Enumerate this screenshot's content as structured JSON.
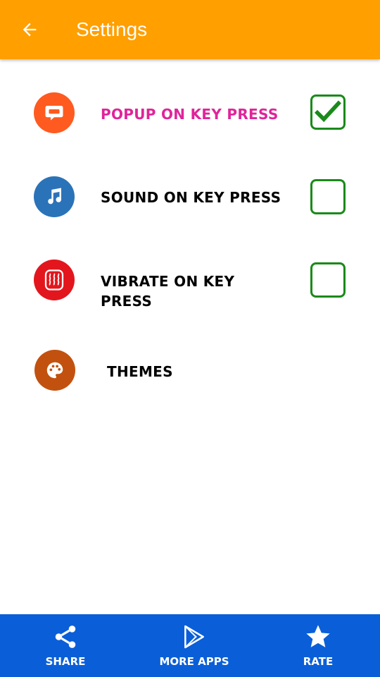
{
  "appbar": {
    "title": "Settings",
    "back_icon": "arrow-left-icon",
    "color": "#ff9f00"
  },
  "settings": [
    {
      "label": "POPUP ON KEY PRESS",
      "icon": "chat-bubble-icon",
      "icon_color": "#ff5a1f",
      "label_color": "#e0249a",
      "checked": true
    },
    {
      "label": "SOUND ON KEY PRESS",
      "icon": "music-notes-icon",
      "icon_color": "#2b73b8",
      "label_color": "#000000",
      "checked": false
    },
    {
      "label": "VIBRATE ON KEY PRESS",
      "icon": "vibration-icon",
      "icon_color": "#e3161d",
      "label_color": "#000000",
      "checked": false
    },
    {
      "label": "THEMES",
      "icon": "palette-icon",
      "icon_color": "#c2510f",
      "label_color": "#000000"
    }
  ],
  "bottom_nav": [
    {
      "label": "SHARE",
      "icon": "share-icon"
    },
    {
      "label": "MORE APPS",
      "icon": "play-store-icon"
    },
    {
      "label": "RATE",
      "icon": "star-icon"
    }
  ],
  "colors": {
    "checkbox_border": "#1a8a1a",
    "bottom_bar": "#0a5fd8"
  }
}
